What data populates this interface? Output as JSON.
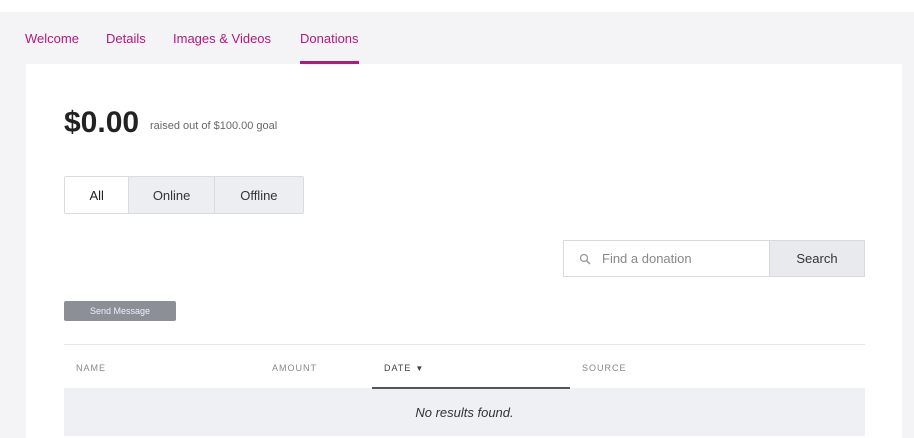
{
  "tabs": [
    {
      "label": "Welcome"
    },
    {
      "label": "Details"
    },
    {
      "label": "Images & Videos"
    },
    {
      "label": "Donations",
      "active": true
    }
  ],
  "summary": {
    "amount": "$0.00",
    "goal_text": "raised out of $100.00 goal"
  },
  "filter": {
    "options": [
      "All",
      "Online",
      "Offline"
    ],
    "selected": "All"
  },
  "search": {
    "placeholder": "Find a donation",
    "button_label": "Search"
  },
  "send_message_label": "Send Message",
  "table": {
    "columns": [
      "NAME",
      "AMOUNT",
      "DATE",
      "SOURCE"
    ],
    "sorted_column": "DATE",
    "empty_text": "No results found."
  },
  "colors": {
    "accent": "#b5177d",
    "background": "#f4f4f6"
  }
}
